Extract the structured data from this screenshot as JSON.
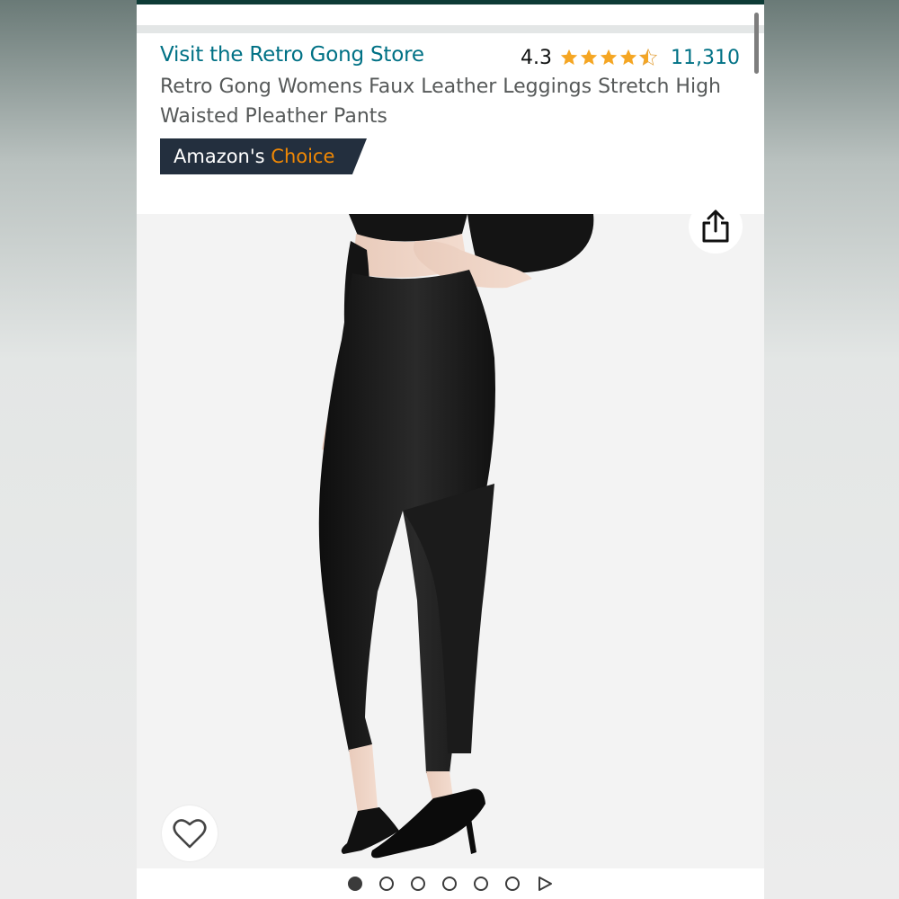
{
  "store": {
    "link_text": "Visit the Retro Gong Store"
  },
  "rating": {
    "value": "4.3",
    "stars_out_of_5": 4.3,
    "count": "11,310"
  },
  "product": {
    "title": "Retro Gong Womens Faux Leather Leggings Stretch High Waisted Pleather Pants"
  },
  "badge": {
    "prefix": "Amazon's",
    "highlight": "Choice"
  },
  "carousel": {
    "total_dots": 6,
    "active_index": 0,
    "has_video": true
  },
  "icons": {
    "share": "share-icon",
    "wishlist": "heart-icon",
    "video": "play-icon"
  },
  "colors": {
    "link": "#007185",
    "star": "#f5a623",
    "badge_bg": "#232f3e",
    "badge_highlight": "#f08804",
    "accent_bar": "#0d3b36"
  }
}
